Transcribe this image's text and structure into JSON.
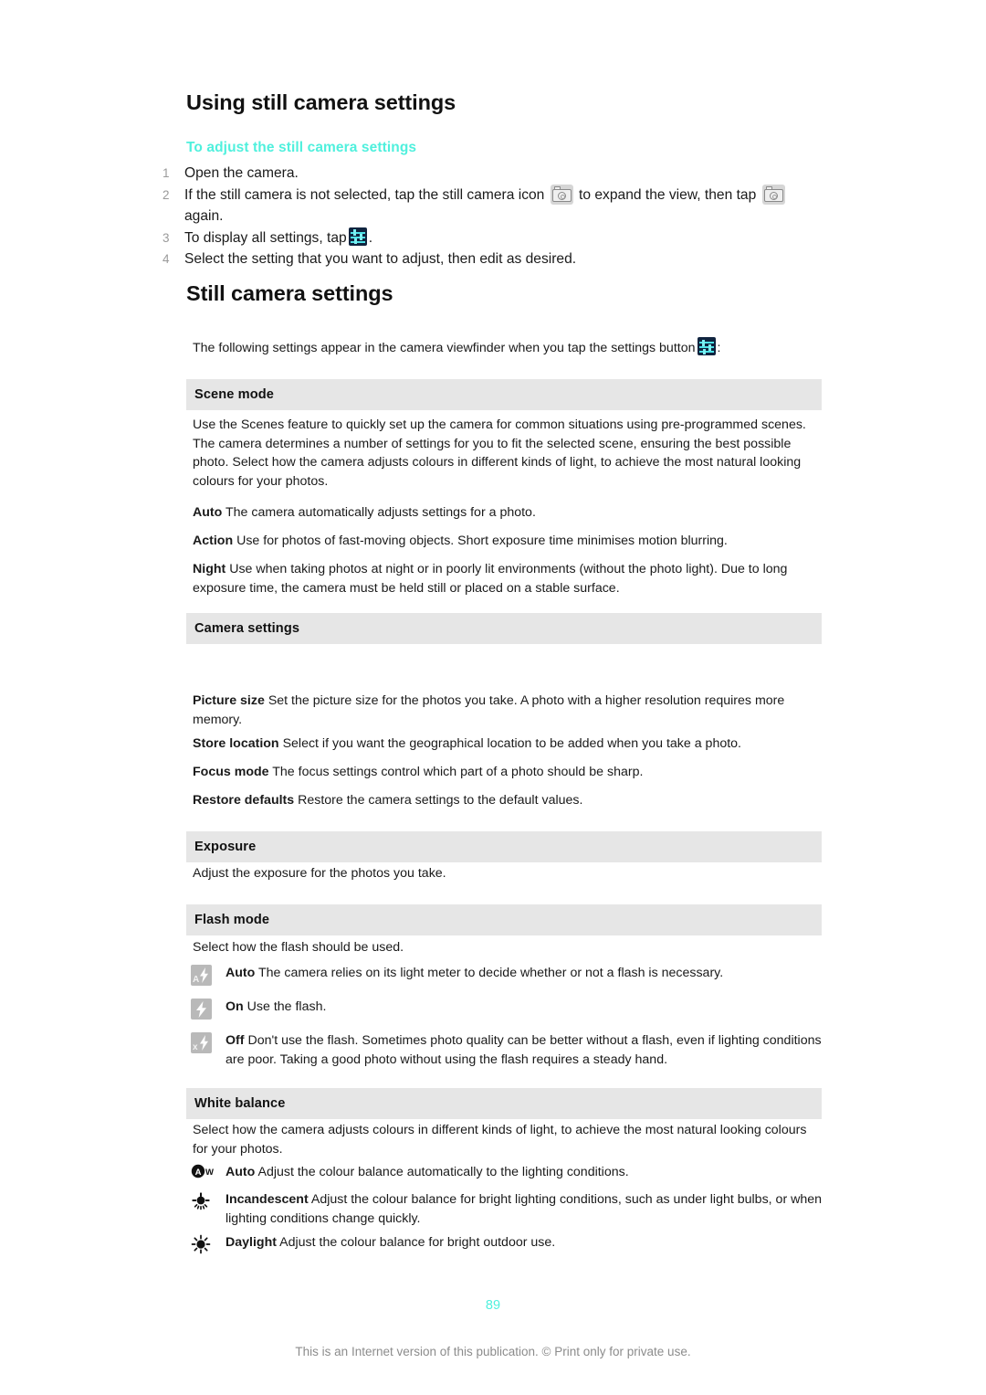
{
  "document": {
    "title_1": "Using still camera settings",
    "subtitle": "To adjust the still camera settings",
    "title_2": "Still camera settings",
    "page_number": "89",
    "footnote": "This is an Internet version of this publication. © Print only for private use."
  },
  "colors": {
    "accent": "#4ff0dd",
    "band": "#e6e6e6",
    "text": "#1a1a1a",
    "muted": "#8c8c8c",
    "settings_icon_bg": "#10243f",
    "settings_icon_fg": "#4fe3e8",
    "flash_icon_bg": "#b9b9b9"
  },
  "steps": [
    {
      "num": "1",
      "pre": "Open the camera.",
      "mid": "",
      "post": ""
    },
    {
      "num": "2",
      "pre": "If the still camera is not selected, tap the still camera icon",
      "mid": "to expand the view, then tap",
      "post": "again."
    },
    {
      "num": "3",
      "pre": "To display all settings, tap",
      "mid": "",
      "post": "."
    },
    {
      "num": "4",
      "pre": "Select the setting that you want to adjust, then edit as desired.",
      "mid": "",
      "post": ""
    }
  ],
  "intro": {
    "pre": "The following settings appear in the camera viewfinder when you tap the settings button",
    "post": ":"
  },
  "sections": [
    {
      "id": "scene-mode",
      "header": "Scene mode",
      "intro": "Use the Scenes feature to quickly set up the camera for common situations using pre-programmed scenes. The camera determines a number of settings for you to fit the selected scene, ensuring the best possible photo. Select how the camera adjusts colours in different kinds of light, to achieve the most natural looking colours for your photos.",
      "options": [
        {
          "term": "Auto",
          "desc": "The camera automatically adjusts settings for a photo."
        },
        {
          "term": "Action",
          "desc": "Use for photos of fast-moving objects. Short exposure time minimises motion blurring."
        },
        {
          "term": "Night",
          "desc": "Use when taking photos at night or in poorly lit environments (without the photo light). Due to long exposure time, the camera must be held still or placed on a stable surface."
        }
      ]
    },
    {
      "id": "camera-settings",
      "header": "Camera settings",
      "options": [
        {
          "term": "Picture size",
          "desc": "Set the picture size for the photos you take. A photo with a higher resolution requires more memory."
        },
        {
          "term": "Store location",
          "desc": "Select if you want the geographical location to be added when you take a photo."
        },
        {
          "term": "Focus mode",
          "desc": "The focus settings control which part of a photo should be sharp."
        },
        {
          "term": "Restore defaults",
          "desc": "Restore the camera settings to the default values."
        }
      ]
    },
    {
      "id": "exposure",
      "header": "Exposure",
      "intro": "Adjust the exposure for the photos you take."
    },
    {
      "id": "flash-mode",
      "header": "Flash mode",
      "intro": "Select how the flash should be used.",
      "options": [
        {
          "icon": "flash-auto-icon",
          "term": "Auto",
          "desc": "The camera relies on its light meter to decide whether or not a flash is necessary."
        },
        {
          "icon": "flash-on-icon",
          "term": "On",
          "desc": "Use the flash."
        },
        {
          "icon": "flash-off-icon",
          "term": "Off",
          "desc": "Don't use the flash. Sometimes photo quality can be better without a flash, even if lighting conditions are poor. Taking a good photo without using the flash requires a steady hand."
        }
      ]
    },
    {
      "id": "white-balance",
      "header": "White balance",
      "intro": "Select how the camera adjusts colours in different kinds of light, to achieve the most natural looking colours for your photos.",
      "options": [
        {
          "icon": "white-balance-auto-icon",
          "term": "Auto",
          "desc": "Adjust the colour balance automatically to the lighting conditions."
        },
        {
          "icon": "incandescent-icon",
          "term": "Incandescent",
          "desc": "Adjust the colour balance for bright lighting conditions, such as under light bulbs, or when lighting conditions change quickly."
        },
        {
          "icon": "daylight-icon",
          "term": "Daylight",
          "desc": "Adjust the colour balance for bright outdoor use."
        }
      ]
    }
  ]
}
